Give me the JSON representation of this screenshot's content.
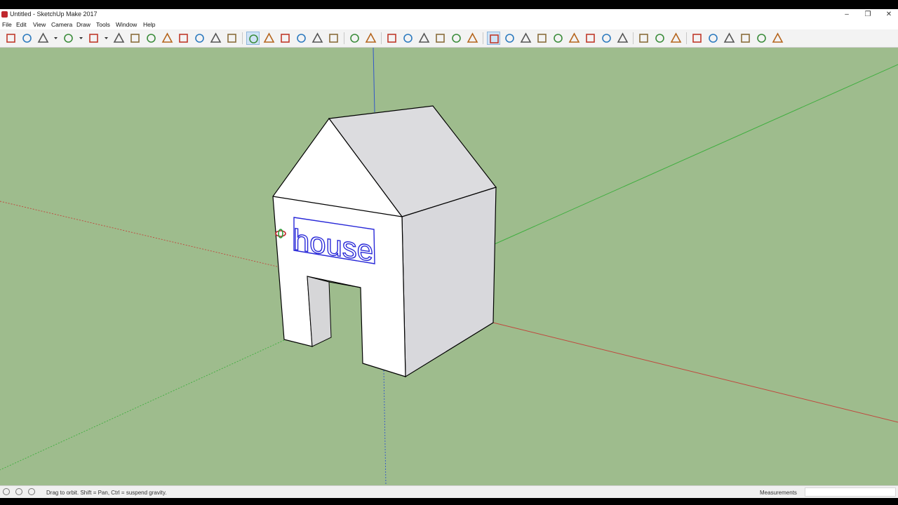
{
  "window": {
    "title": "Untitled - SketchUp Make 2017",
    "app_icon": "sketchup-logo-icon",
    "controls": [
      "minimize-icon",
      "restore-icon",
      "close-icon"
    ],
    "control_glyphs": {
      "minimize": "–",
      "restore": "❐",
      "close": "✕"
    }
  },
  "menu": {
    "items": [
      "File",
      "Edit",
      "View",
      "Camera",
      "Draw",
      "Tools",
      "Window",
      "Help"
    ]
  },
  "toolbar": {
    "tools": [
      "select-icon",
      "eraser-icon",
      "line-icon",
      "line-dropdown-icon",
      "arc-icon",
      "arc-dropdown-icon",
      "rectangle-icon",
      "rectangle-dropdown-icon",
      "push-pull-icon",
      "follow-me-icon",
      "move-icon",
      "rotate-icon",
      "scale-icon",
      "tape-measure-icon",
      "text-icon",
      "paint-bucket-icon",
      "orbit-icon",
      "pan-icon",
      "zoom-icon",
      "zoom-extents-icon",
      "3d-warehouse-icon",
      "extension-warehouse-icon",
      "layout-icon",
      "ruby-icon",
      "iso-view-icon",
      "top-view-icon",
      "front-view-icon",
      "right-view-icon",
      "back-view-icon",
      "left-view-icon",
      "orbit-walk-icon",
      "pan-walk-icon",
      "zoom-walk-icon",
      "zoom-window-icon",
      "zoom-extents-walk-icon",
      "previous-view-icon",
      "position-camera-icon",
      "look-around-icon",
      "walk-icon",
      "axes-icon",
      "section-plane-icon",
      "display-section-icon",
      "xray-style-icon",
      "wireframe-style-icon",
      "hidden-line-style-icon",
      "shaded-style-icon",
      "shaded-textures-style-icon",
      "monochrome-style-icon"
    ],
    "active_tools": [
      "orbit-icon",
      "orbit-walk-icon"
    ]
  },
  "scene": {
    "background_color": "#9ebc8d",
    "axis_colors": {
      "red": "#c0473d",
      "green": "#3fae3f",
      "blue": "#3357c8"
    },
    "model_text": "house"
  },
  "status": {
    "hint": "Drag to orbit. Shift = Pan, Ctrl = suspend gravity.",
    "measurements_label": "Measurements",
    "measurements_value": ""
  }
}
